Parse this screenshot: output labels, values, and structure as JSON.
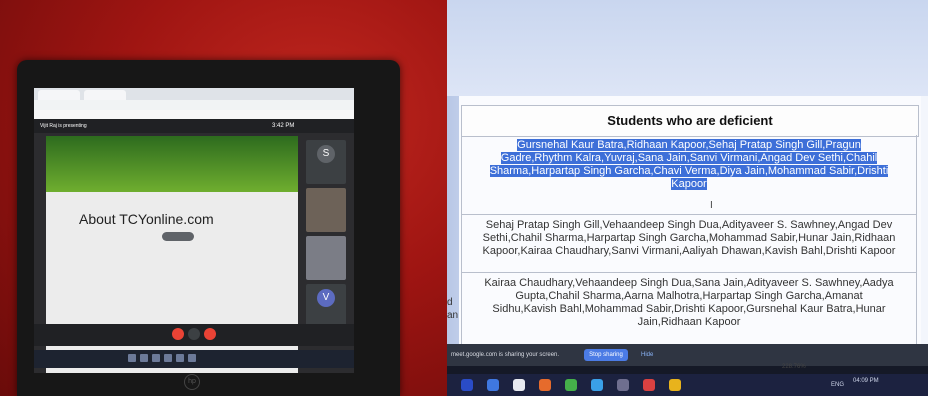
{
  "left_photo": {
    "meet": {
      "presenting_text": "Vijit Raj is presenting",
      "time": "3:42 PM"
    },
    "slide": {
      "title": "About TCYonline.com"
    },
    "tiles": [
      {
        "letter": "S",
        "color": "#5f6368"
      },
      {
        "letter": "",
        "color": "#3c4043"
      },
      {
        "letter": "",
        "color": "#3c4043"
      },
      {
        "letter": "V",
        "color": "#5c6bc0"
      }
    ]
  },
  "right_photo": {
    "table": {
      "title": "Students who are deficient",
      "rows": [
        "Gursnehal Kaur Batra,Ridhaan Kapoor,Sehaj Pratap Singh Gill,Pragun Gadre,Rhythm Kalra,Yuvraj,Sana Jain,Sanvi Virmani,Angad Dev Sethi,Chahil Sharma,Harpartap Singh Garcha,Chavi Verma,Diya Jain,Mohammad Sabir,Drishti Kapoor",
        "Sehaj Pratap Singh Gill,Vehaandeep Singh Dua,Adityaveer S. Sawhney,Angad Dev Sethi,Chahil Sharma,Harpartap Singh Garcha,Mohammad Sabir,Hunar Jain,Ridhaan Kapoor,Kairaa Chaudhary,Sanvi Virmani,Aaliyah Dhawan,Kavish Bahl,Drishti Kapoor",
        "Kairaa Chaudhary,Vehaandeep Singh Dua,Sana Jain,Adityaveer S. Sawhney,Aadya Gupta,Chahil Sharma,Aarna Malhotra,Harpartap Singh Garcha,Amanat Sidhu,Kavish Bahl,Mohammad Sabir,Drishti Kapoor,Gursnehal Kaur Batra,Hunar Jain,Ridhaan Kapoor"
      ],
      "left_sliver": "d\nan"
    },
    "share_bar": {
      "text": "meet.google.com is sharing your screen.",
      "stop_label": "Stop sharing",
      "hide_label": "Hide"
    },
    "zoom": "228.76%",
    "taskbar": {
      "lang": "ENG",
      "time": "04:09 PM"
    }
  }
}
